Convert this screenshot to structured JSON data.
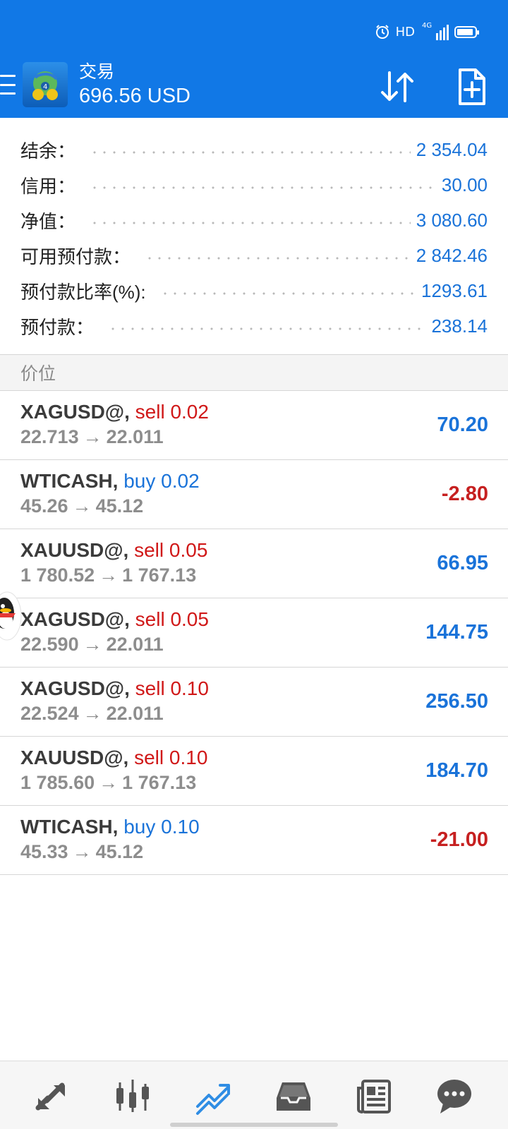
{
  "colors": {
    "appbar": "#1178e6",
    "accent_blue": "#1a73d9",
    "loss_red": "#c62020",
    "sell_red": "#d01818"
  },
  "status_bar": {
    "hd": "HD",
    "network": "4G",
    "icons": [
      "alarm-icon",
      "signal-icon",
      "battery-icon"
    ]
  },
  "header": {
    "title": "交易",
    "balance": "696.56 USD",
    "icons": [
      "menu-icon",
      "metatrader-logo",
      "sort-icon",
      "new-order-icon"
    ]
  },
  "summary": [
    {
      "label": "结余：",
      "value": "2 354.04"
    },
    {
      "label": "信用：",
      "value": "30.00"
    },
    {
      "label": "净值：",
      "value": "3 080.60"
    },
    {
      "label": "可用预付款：",
      "value": "2 842.46"
    },
    {
      "label": "预付款比率(%):",
      "value": "1293.61"
    },
    {
      "label": "预付款：",
      "value": "238.14"
    }
  ],
  "section_title": "价位",
  "positions": [
    {
      "symbol": "XAGUSD@,",
      "side": "sell 0.02",
      "open": "22.713",
      "arrow": "→",
      "current": "22.011",
      "profit": "70.20"
    },
    {
      "symbol": "WTICASH,",
      "side": "buy 0.02",
      "open": "45.26",
      "arrow": "→",
      "current": "45.12",
      "profit": "-2.80"
    },
    {
      "symbol": "XAUUSD@,",
      "side": "sell 0.05",
      "open": "1 780.52",
      "arrow": "→",
      "current": "1 767.13",
      "profit": "66.95"
    },
    {
      "symbol": "XAGUSD@,",
      "side": "sell 0.05",
      "open": "22.590",
      "arrow": "→",
      "current": "22.011",
      "profit": "144.75"
    },
    {
      "symbol": "XAGUSD@,",
      "side": "sell 0.10",
      "open": "22.524",
      "arrow": "→",
      "current": "22.011",
      "profit": "256.50"
    },
    {
      "symbol": "XAUUSD@,",
      "side": "sell 0.10",
      "open": "1 785.60",
      "arrow": "→",
      "current": "1 767.13",
      "profit": "184.70"
    },
    {
      "symbol": "WTICASH,",
      "side": "buy 0.10",
      "open": "45.33",
      "arrow": "→",
      "current": "45.12",
      "profit": "-21.00"
    }
  ],
  "bottom_nav": {
    "items": [
      "quotes-icon",
      "chart-icon",
      "trade-icon",
      "history-icon",
      "news-icon",
      "chat-icon"
    ],
    "active": "trade-icon"
  }
}
